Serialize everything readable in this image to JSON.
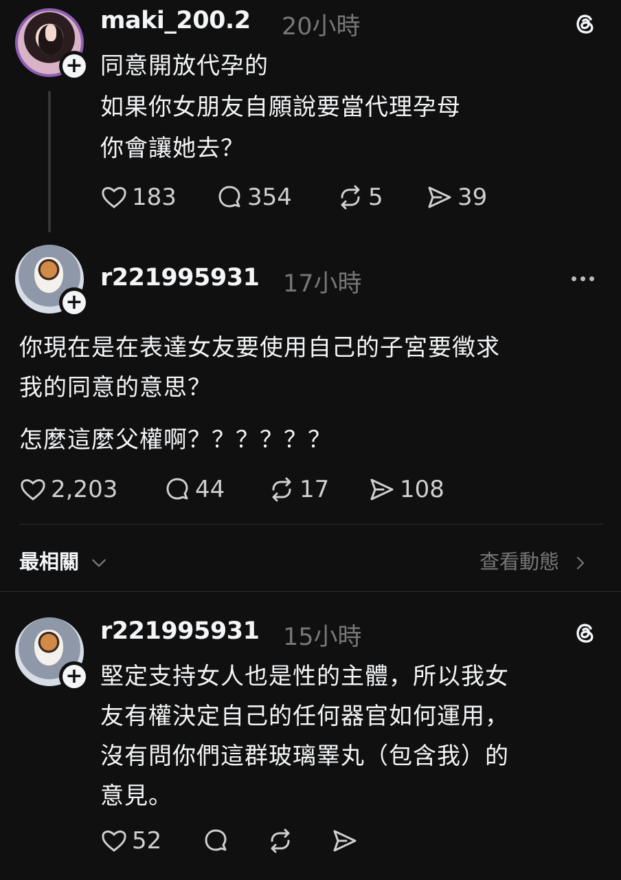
{
  "posts": [
    {
      "username": "maki_200.2",
      "time": "20小時",
      "lines": [
        "同意開放代孕的",
        "如果你女朋友自願說要當代理孕母",
        "你會讓她去？"
      ],
      "likes": "183",
      "replies": "354",
      "reposts": "5",
      "shares": "39"
    },
    {
      "username": "r221995931",
      "time": "17小時",
      "lines": [
        "你現在是在表達女友要使用自己的子宮要徵求",
        "我的同意的意思？"
      ],
      "extra": "怎麼這麼父權啊？？？？？？",
      "likes": "2,203",
      "replies": "44",
      "reposts": "17",
      "shares": "108"
    },
    {
      "username": "r221995931",
      "time": "15小時",
      "lines": [
        "堅定支持女人也是性的主體，所以我女",
        "友有權決定自己的任何器官如何運用，",
        "沒有問你們這群玻璃睪丸（包含我）的",
        "意見。"
      ],
      "likes": "52"
    }
  ],
  "sort": {
    "label": "最相關",
    "activity": "查看動態"
  },
  "icons": [
    "threads-logo-icon",
    "more-icon",
    "heart-icon",
    "comment-icon",
    "repost-icon",
    "share-icon",
    "chevron-down-icon",
    "chevron-right-icon",
    "plus-icon"
  ],
  "colors": {
    "background": "#101010",
    "text": "#f3f5f7",
    "muted": "#777777",
    "avatar_ring": "#8e5fb4"
  }
}
